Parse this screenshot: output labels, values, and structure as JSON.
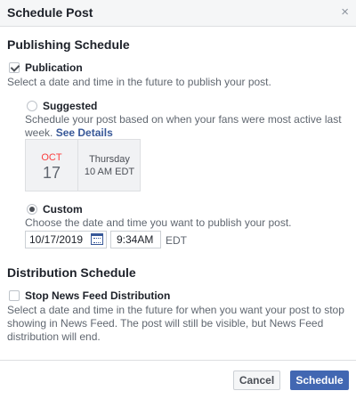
{
  "dialog": {
    "title": "Schedule Post",
    "close_glyph": "×"
  },
  "publishing": {
    "title": "Publishing Schedule",
    "publication_label": "Publication",
    "publication_help": "Select a date and time in the future to publish your post.",
    "suggested_label": "Suggested",
    "suggested_help_1": "Schedule your post based on when your fans were most active last",
    "suggested_help_2": "week.",
    "see_details": "See Details",
    "suggested_month": "OCT",
    "suggested_day": "17",
    "suggested_weekday": "Thursday",
    "suggested_time": "10 AM EDT",
    "custom_label": "Custom",
    "custom_help": "Choose the date and time you want to publish your post.",
    "date_value": "10/17/2019",
    "time_value": "9:34AM",
    "timezone": "EDT"
  },
  "distribution": {
    "title": "Distribution Schedule",
    "stop_label": "Stop News Feed Distribution",
    "help_1": "Select a date and time in the future for when you want your post to stop",
    "help_2": "showing in News Feed. The post will still be visible, but News Feed",
    "help_3": "distribution will end."
  },
  "footer": {
    "cancel": "Cancel",
    "schedule": "Schedule"
  }
}
